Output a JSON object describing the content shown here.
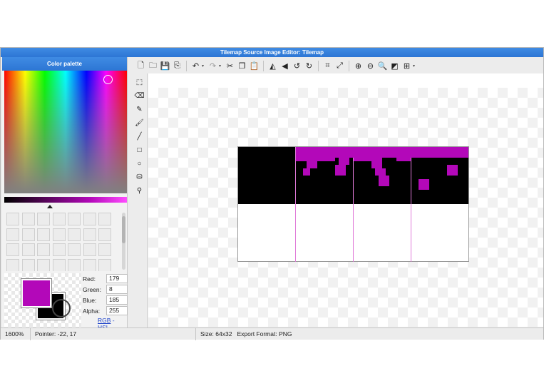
{
  "window": {
    "title": "Tilemap Source Image Editor: Tilemap"
  },
  "palette": {
    "header": "Color palette",
    "foreground_color": "#b308b9",
    "background_color": "#000000",
    "fields": [
      {
        "label": "Red:",
        "value": "179"
      },
      {
        "label": "Green:",
        "value": "8"
      },
      {
        "label": "Blue:",
        "value": "185"
      },
      {
        "label": "Alpha:",
        "value": "255"
      }
    ],
    "mode_rgb": "RGB",
    "mode_sep": " - ",
    "mode_hsl": "HSL"
  },
  "toolbar": {
    "groups": [
      [
        "new-file-icon",
        "open-folder-icon",
        "save-icon",
        "save-as-icon"
      ],
      [
        "undo-icon",
        "redo-icon",
        "cut-icon",
        "copy-icon",
        "paste-icon"
      ],
      [
        "flip-horizontal-icon",
        "flip-vertical-icon",
        "rotate-left-icon",
        "rotate-right-icon"
      ],
      [
        "crop-icon",
        "resize-icon"
      ],
      [
        "zoom-in-icon",
        "zoom-out-icon",
        "zoom-reset-icon",
        "toggle-background-icon",
        "grid-icon"
      ]
    ]
  },
  "tools": [
    "select-rect-icon",
    "eraser-icon",
    "pencil-icon",
    "brush-icon",
    "line-icon",
    "rectangle-icon",
    "ellipse-icon",
    "fill-bucket-icon",
    "eyedropper-icon"
  ],
  "colors": {
    "accent": "#2d76d4",
    "pixel": "#b308b9",
    "tile_bg": "#000000",
    "grid": "#e07ad8"
  },
  "status": {
    "zoom": "1600%",
    "pointer": "Pointer: -22, 17",
    "size_export": "Size: 64x32   Export Format: PNG"
  }
}
